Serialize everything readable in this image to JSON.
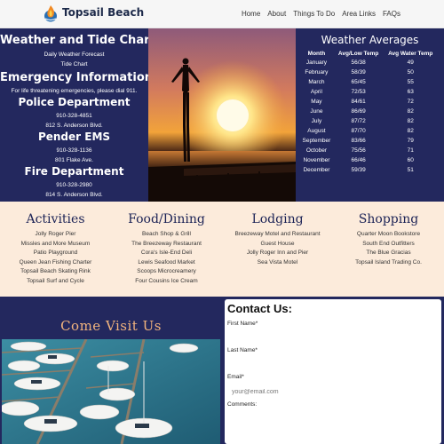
{
  "header": {
    "brand": "Topsail Beach",
    "nav": [
      "Home",
      "About",
      "Things To Do",
      "Area Links",
      "FAQs"
    ]
  },
  "left_panel": {
    "weather_title": "Weather and Tide Chart",
    "weather_links": [
      "Daily Weather Forecast",
      "Tide Chart"
    ],
    "emergency_title": "Emergency Information",
    "emergency_note": "For life threatening emergencies, please dial 911.",
    "police": {
      "title": "Police Department",
      "phone": "910-328-4851",
      "address": "812 S. Anderson Blvd."
    },
    "ems": {
      "title": "Pender EMS",
      "phone": "910-328-1136",
      "address": "801 Flake Ave."
    },
    "fire": {
      "title": "Fire Department",
      "phone": "910-328-2980",
      "address": "814 S. Anderson Blvd."
    }
  },
  "weather_averages": {
    "title": "Weather Averages",
    "headers": [
      "Month",
      "Avg/Low Temp",
      "Avg Water Temp"
    ],
    "rows": [
      [
        "January",
        "56/38",
        "49"
      ],
      [
        "February",
        "58/39",
        "50"
      ],
      [
        "March",
        "65/45",
        "55"
      ],
      [
        "April",
        "72/53",
        "63"
      ],
      [
        "May",
        "84/61",
        "72"
      ],
      [
        "June",
        "86/69",
        "82"
      ],
      [
        "July",
        "87/72",
        "82"
      ],
      [
        "August",
        "87/70",
        "82"
      ],
      [
        "September",
        "83/66",
        "79"
      ],
      [
        "October",
        "75/56",
        "71"
      ],
      [
        "November",
        "66/46",
        "60"
      ],
      [
        "December",
        "59/39",
        "51"
      ]
    ]
  },
  "sections": [
    {
      "title": "Activities",
      "items": [
        "Jolly Roger Pier",
        "Missles and More Museum",
        "Patio Playground",
        "Queen Jean Fishing Charter",
        "Topsail Beach Skating Rink",
        "Topsail Surf and Cycle"
      ]
    },
    {
      "title": "Food/Dining",
      "items": [
        "Beach Shop & Grill",
        "The Breezeway Restaurant",
        "Cora's Isle-End Deli",
        "Lewis Seafood Market",
        "Scoops Microcreamery",
        "Four Cousins Ice Cream"
      ]
    },
    {
      "title": "Lodging",
      "items": [
        "Breezeway Motel and Restaurant",
        "Guest House",
        "Jolly Roger Inn and Pier",
        "Sea Vista Motel"
      ]
    },
    {
      "title": "Shopping",
      "items": [
        "Quarter Moon Bookstore",
        "South End Outfitters",
        "The Blue Gracias",
        "Topsail Island Trading Co."
      ]
    }
  ],
  "visit": {
    "title": "Come Visit Us"
  },
  "contact": {
    "title": "Contact Us:",
    "first_name_label": "First Name*",
    "last_name_label": "Last Name*",
    "email_label": "Email*",
    "email_placeholder": "your@email.com",
    "comments_label": "Comments:"
  },
  "colors": {
    "navy": "#23285e",
    "peach": "#fcebdb",
    "accent": "#f2b47e"
  }
}
